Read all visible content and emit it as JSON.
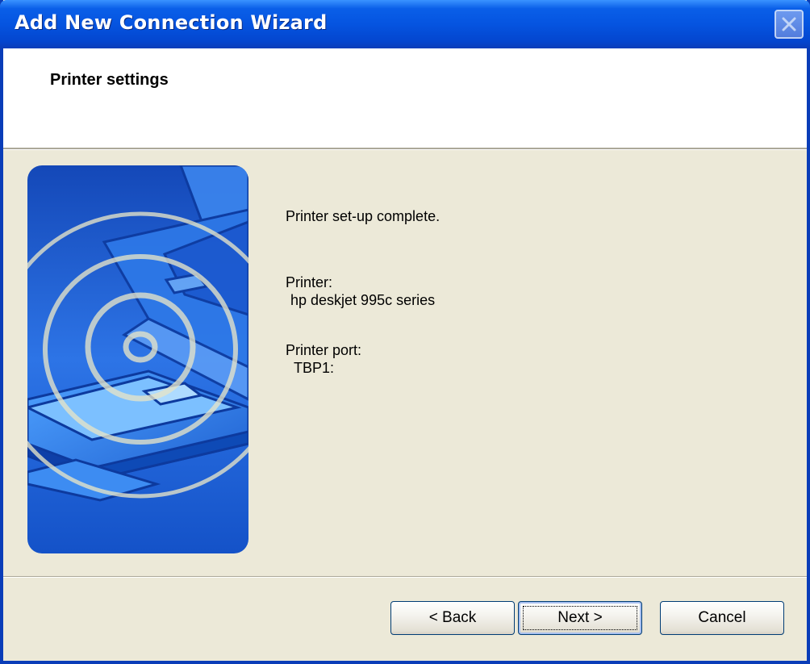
{
  "window": {
    "title": "Add New Connection Wizard"
  },
  "header": {
    "title": "Printer settings"
  },
  "content": {
    "status": "Printer set-up complete.",
    "printer_label": "Printer:",
    "printer_value": "hp deskjet 995c series",
    "port_label": "Printer port:",
    "port_value": "TBP1:"
  },
  "buttons": {
    "back": "< Back",
    "next": "Next >",
    "cancel": "Cancel"
  },
  "icons": {
    "close": "close-icon",
    "illustration": "wireless-printer-laptop-illustration"
  },
  "colors": {
    "titlebar": "#0554E0",
    "dialog_bg": "#ECE9D8",
    "header_bg": "#FFFFFF",
    "illustration_bg": "#1E63D8"
  }
}
